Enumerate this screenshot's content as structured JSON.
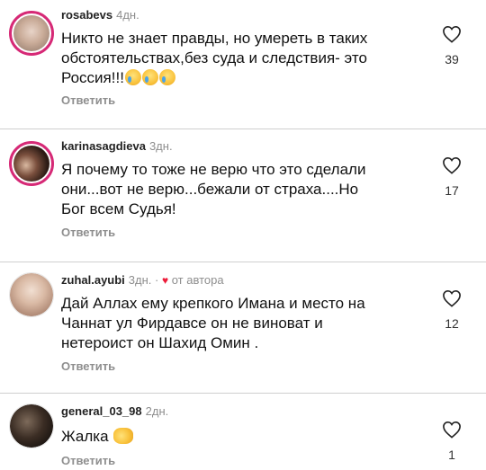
{
  "comments": [
    {
      "username": "rosabevs",
      "time": "4дн.",
      "text": "Никто не знает правды, но умереть в таких обстоятельствах,без суда и следствия- это Россия!!!",
      "emojis": [
        "crying-face-emoji",
        "crying-face-emoji",
        "crying-face-emoji"
      ],
      "likes": "39",
      "reply_label": "Ответить",
      "author_liked": false
    },
    {
      "username": "karinasagdieva",
      "time": "3дн.",
      "text": "Я почему то тоже не верю что это сделали они...вот не верю...бежали от страха....Но Бог всем Судья!",
      "emojis": [],
      "likes": "17",
      "reply_label": "Ответить",
      "author_liked": false
    },
    {
      "username": "zuhal.ayubi",
      "time": "3дн.",
      "author_like_label": "от автора",
      "text": "Дай Аллах ему крепкого Имана и место на Чаннат ул Фирдавсе он не виноват и нетероист он Шахид Омин .",
      "emojis": [],
      "likes": "12",
      "reply_label": "Ответить",
      "author_liked": true
    },
    {
      "username": "general_03_98",
      "time": "2дн.",
      "text": "Жалка",
      "emojis": [
        "open-hands-emoji"
      ],
      "likes": "1",
      "reply_label": "Ответить",
      "author_liked": false
    }
  ],
  "colors": {
    "story_ring": "#d62976",
    "author_heart": "#ed1c3a",
    "secondary_text": "#8e8e8e"
  },
  "icons": {
    "like": "heart-outline-icon",
    "author_like": "heart-filled-icon"
  }
}
